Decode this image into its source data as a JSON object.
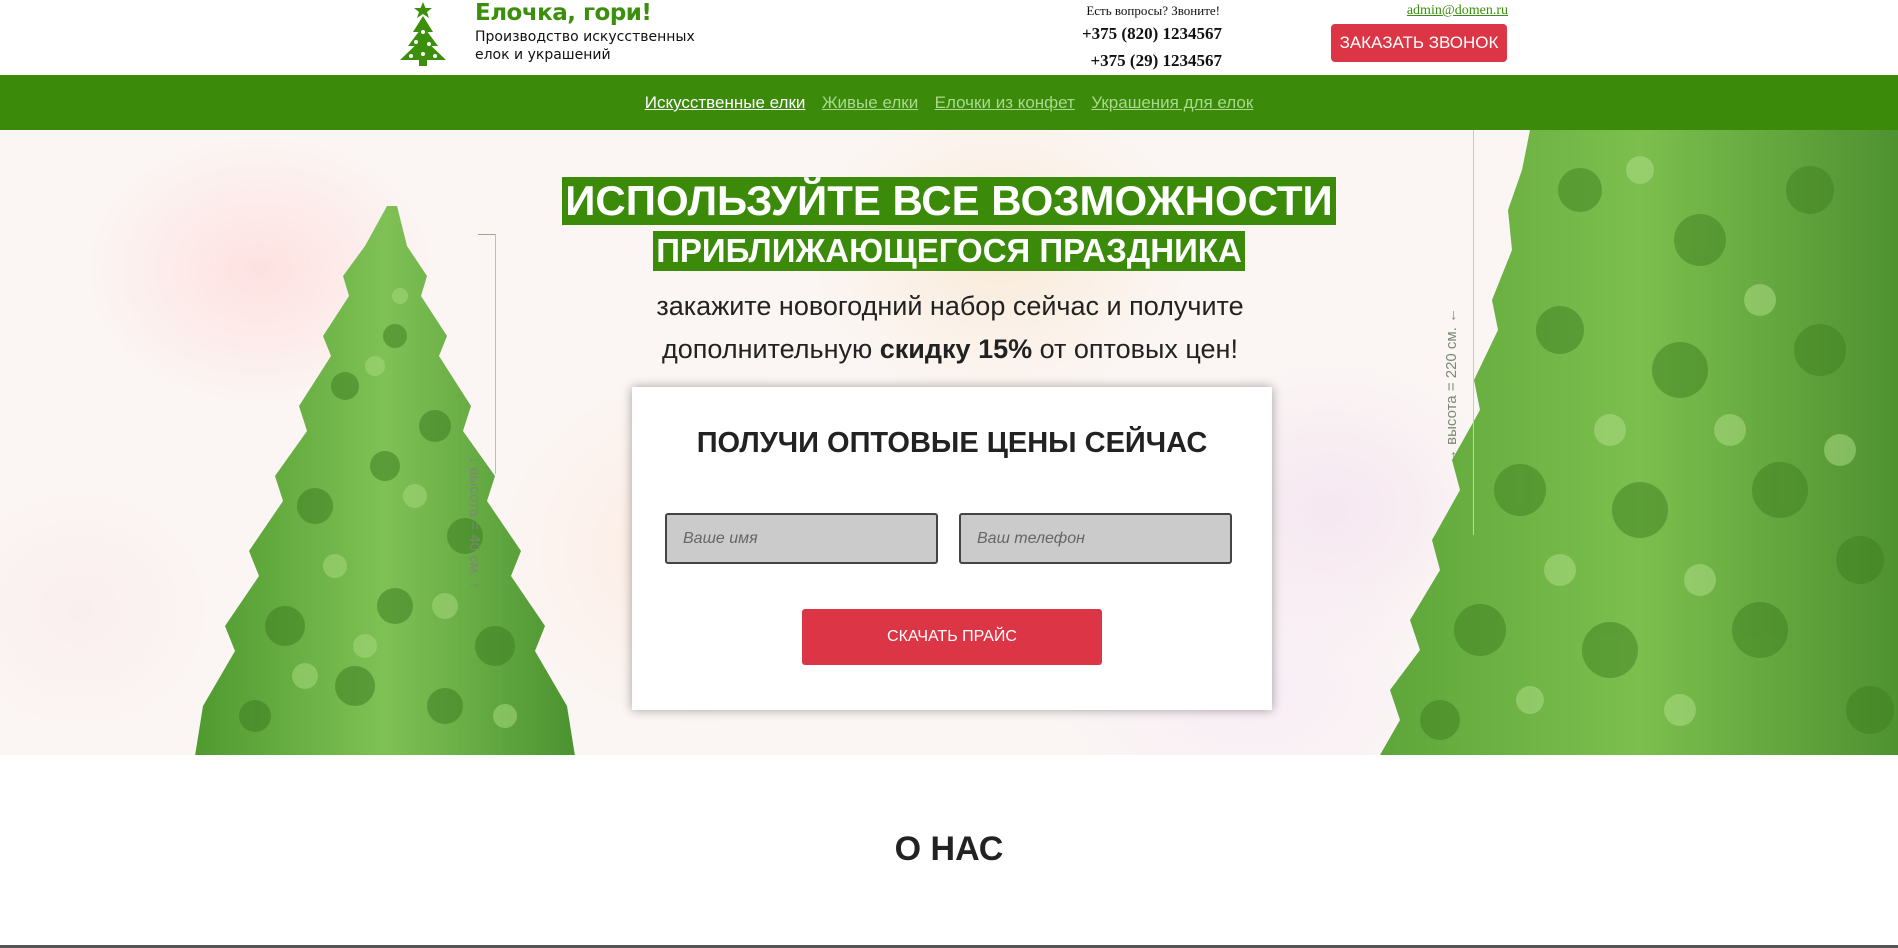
{
  "colors": {
    "brand_green": "#3b8a0a",
    "accent_red": "#dc3545",
    "logo_green": "#3b8f0c"
  },
  "header": {
    "logo_icon": "christmas-tree-icon",
    "brand_name": "Елочка, гори!",
    "tagline": "Производство искусственных елок и украшений",
    "contact_question": "Есть вопросы? Звоните!",
    "phones": [
      "+375 (820) 1234567",
      "+375 (29) 1234567"
    ],
    "email": "admin@domen.ru",
    "callback_label": "ЗАКАЗАТЬ ЗВОНОК"
  },
  "nav": {
    "items": [
      {
        "label": "Искусственные елки",
        "active": true
      },
      {
        "label": "Живые елки",
        "active": false
      },
      {
        "label": "Елочки из конфет",
        "active": false
      },
      {
        "label": "Украшения для елок",
        "active": false
      }
    ]
  },
  "hero": {
    "headline_line1": "ИСПОЛЬЗУЙТЕ ВСЕ ВОЗМОЖНОСТИ",
    "headline_line2": "ПРИБЛИЖАЮЩЕГОСЯ ПРАЗДНИКА",
    "sub_part1": "закажите новогодний набор сейчас и получите дополнительную",
    "sub_bold": "скидку 15%",
    "sub_part2": "от оптовых цен!",
    "left_tree_height_label": "высота = 40 см.",
    "right_tree_height_label": "высота = 220 см."
  },
  "form": {
    "title": "ПОЛУЧИ ОПТОВЫЕ ЦЕНЫ СЕЙЧАС",
    "name_placeholder": "Ваше имя",
    "phone_placeholder": "Ваш телефон",
    "submit_label": "СКАЧАТЬ ПРАЙС"
  },
  "about": {
    "title": "О НАС"
  }
}
